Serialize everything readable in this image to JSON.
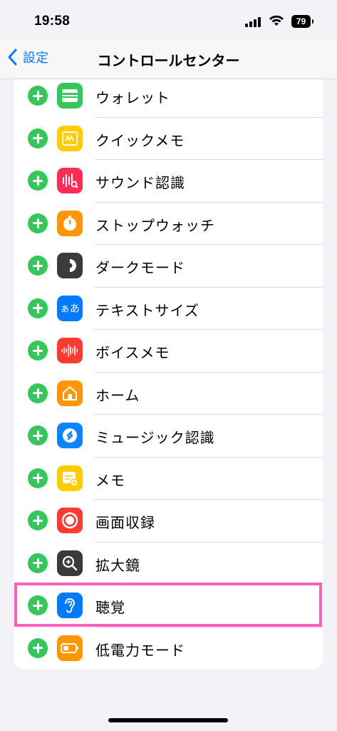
{
  "status": {
    "time": "19:58",
    "battery": "79"
  },
  "nav": {
    "back_label": "設定",
    "title": "コントロールセンター"
  },
  "items": [
    {
      "label": "ウォレット",
      "icon": "wallet-icon",
      "color": "#34c759"
    },
    {
      "label": "クイックメモ",
      "icon": "quick-note-icon",
      "color": "#ffcc00"
    },
    {
      "label": "サウンド認識",
      "icon": "sound-recognition-icon",
      "color": "#ff2d55"
    },
    {
      "label": "ストップウォッチ",
      "icon": "stopwatch-icon",
      "color": "#ff9500"
    },
    {
      "label": "ダークモード",
      "icon": "dark-mode-icon",
      "color": "#3a3a3c"
    },
    {
      "label": "テキストサイズ",
      "icon": "text-size-icon",
      "color": "#007aff",
      "glyph": "ぁあ"
    },
    {
      "label": "ボイスメモ",
      "icon": "voice-memo-icon",
      "color": "#ff3b30"
    },
    {
      "label": "ホーム",
      "icon": "home-icon",
      "color": "#ff9500"
    },
    {
      "label": "ミュージック認識",
      "icon": "shazam-icon",
      "color": "#0a84ff"
    },
    {
      "label": "メモ",
      "icon": "notes-icon",
      "color": "#ffcc00"
    },
    {
      "label": "画面収録",
      "icon": "screen-recording-icon",
      "color": "#ff3b30"
    },
    {
      "label": "拡大鏡",
      "icon": "magnifier-icon",
      "color": "#3a3a3c"
    },
    {
      "label": "聴覚",
      "icon": "hearing-icon",
      "color": "#007aff"
    },
    {
      "label": "低電力モード",
      "icon": "low-power-mode-icon",
      "color": "#ff9500"
    }
  ],
  "highlight_color": "#ff5fbf",
  "accent_color": "#0a7aff"
}
